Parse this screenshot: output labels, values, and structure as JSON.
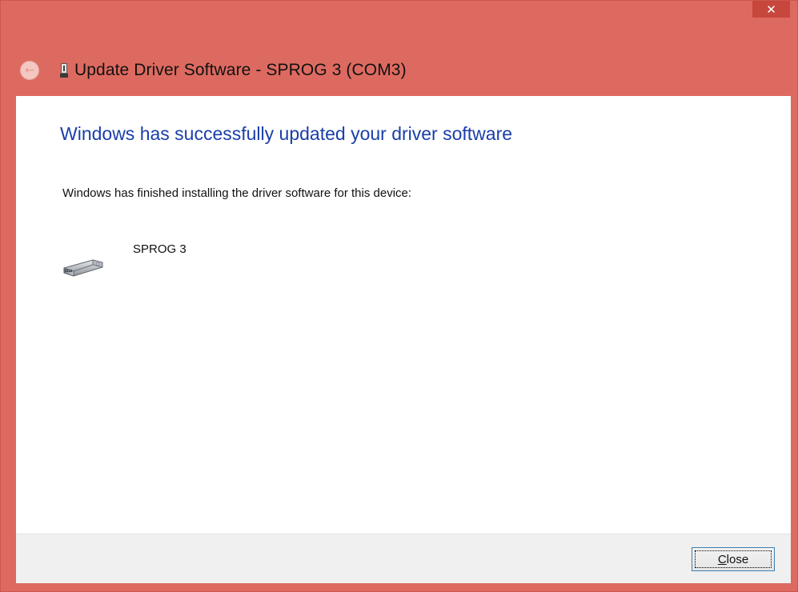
{
  "window": {
    "title": "Update Driver Software - SPROG 3 (COM3)",
    "close_glyph": "✕",
    "back_glyph": "←",
    "icons": {
      "back": "back-arrow-icon",
      "title": "usb-plug-icon",
      "device": "serial-port-icon",
      "close": "close-icon"
    },
    "colors": {
      "frame": "#dd6a60",
      "close_button": "#c7473c",
      "heading": "#1a3eaa"
    }
  },
  "main": {
    "heading": "Windows has successfully updated your driver software",
    "info_text": "Windows has finished installing the driver software for this device:",
    "device_name": "SPROG 3"
  },
  "footer": {
    "close_accel": "C",
    "close_rest": "lose"
  }
}
